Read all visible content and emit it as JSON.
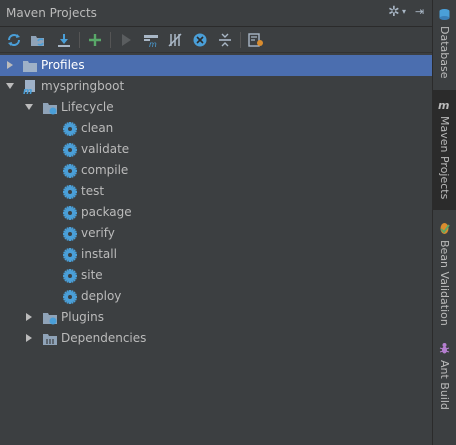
{
  "panel": {
    "title": "Maven Projects"
  },
  "toolbar": {
    "buttons": [
      {
        "icon": "reimport-icon"
      },
      {
        "icon": "generate-sources-icon"
      },
      {
        "icon": "download-icon"
      },
      {
        "icon": "add-icon"
      },
      {
        "icon": "run-icon"
      },
      {
        "icon": "execute-goal-icon"
      },
      {
        "icon": "toggle-offline-icon"
      },
      {
        "icon": "skip-tests-icon"
      },
      {
        "icon": "collapse-all-icon"
      },
      {
        "icon": "settings-icon"
      }
    ]
  },
  "tree": {
    "profiles": "Profiles",
    "project": "myspringboot",
    "lifecycle": "Lifecycle",
    "goals": [
      "clean",
      "validate",
      "compile",
      "test",
      "package",
      "verify",
      "install",
      "site",
      "deploy"
    ],
    "plugins": "Plugins",
    "dependencies": "Dependencies"
  },
  "sidebar": {
    "tabs": [
      {
        "label": "Database",
        "icon": "database-icon",
        "active": false
      },
      {
        "label": "Maven Projects",
        "icon": "maven-icon",
        "active": true
      },
      {
        "label": "Bean Validation",
        "icon": "bean-validation-icon",
        "active": false
      },
      {
        "label": "Ant Build",
        "icon": "ant-icon",
        "active": false
      }
    ]
  },
  "colors": {
    "background": "#3c3f41",
    "selection": "#4b6eaf",
    "gear": "#4a9fd8",
    "folder": "#8fa3b8",
    "add": "#59a869"
  }
}
